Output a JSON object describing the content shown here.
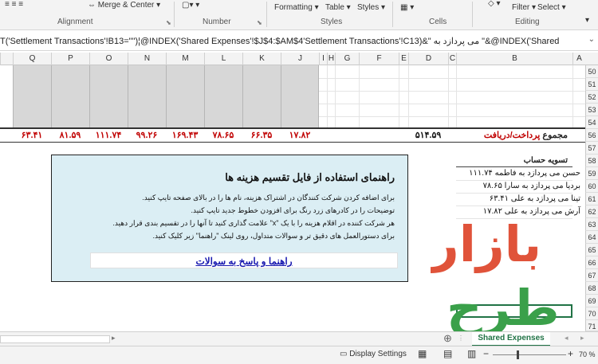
{
  "ribbon": {
    "groups": {
      "alignment": "Alignment",
      "number": "Number",
      "styles": "Styles",
      "cells": "Cells",
      "editing": "Editing"
    },
    "buttons": {
      "merge_center": "Merge & Center",
      "formatting": "Formatting",
      "table": "Table",
      "styles": "Styles",
      "filter": "Filter",
      "select": "Select"
    }
  },
  "formula_bar": {
    "text": "T('Settlement Transactions'!B13=\"\")¦@INDEX('Shared Expenses'!$J$4:$AM$4'Settlement Transactions'!C13)&\" می پردازد به \"&@INDEX('Shared"
  },
  "columns": [
    "Q",
    "P",
    "O",
    "N",
    "M",
    "L",
    "K",
    "J",
    "I",
    "H",
    "G",
    "F",
    "E",
    "D",
    "C",
    "B",
    "A"
  ],
  "rows": [
    "50",
    "51",
    "52",
    "53",
    "54",
    "55",
    "56",
    "57",
    "58",
    "59",
    "60",
    "61",
    "62",
    "63",
    "64",
    "65",
    "66",
    "67",
    "68",
    "69",
    "70",
    "71"
  ],
  "totals": {
    "values": [
      "۶۳.۴۱",
      "۸۱.۵۹",
      "۱۱۱.۷۴",
      "۹۹.۲۶",
      "۱۶۹.۴۳",
      "۷۸.۶۵",
      "۶۶.۳۵",
      "۱۷.۸۲"
    ],
    "grand_total": "۵۱۴.۵۹",
    "label_prefix": "مجموع ",
    "label_highlight": "پرداخت/دریافت"
  },
  "help": {
    "title": "راهنمای استفاده از فایل تقسیم هزینه ها",
    "lines": [
      "برای اضافه کردن شرکت کنندگان در اشتراک هزینه، نام ها را در بالای صفحه تایپ کنید.",
      "توضیحات را در کادرهای زرد رنگ برای افزودن خطوط جدید تایپ کنید.",
      "هر شرکت کننده در اقلام هزینه را با یک \"x\" علامت گذاری کنید تا آنها را در تقسیم بندی قرار دهید.",
      "برای دستورالعمل های دقیق تر و سوالات متداول، روی لینک \"راهنما\" زیر کلیک کنید."
    ],
    "link": "راهنما و پاسخ به سوالات"
  },
  "settlement": {
    "title": "تسویه حساب",
    "lines": [
      "حسن می پردازد به فاطمه ۱۱۱.۷۴",
      "بردیا می پردازد به سارا ۷۸.۶۵",
      "تینا می پردازد به علی ۶۳.۴۱",
      "آرش می پردازد به علی ۱۷.۸۲"
    ]
  },
  "watermark": {
    "word1": "بازار",
    "word2": "طرح",
    "color_red": "#e0533a",
    "color_green": "#3aa04a"
  },
  "sheet_tab": "Shared Expenses",
  "status": {
    "display_settings": "Display Settings",
    "zoom": "70 %"
  },
  "colors": {
    "accent": "#217346",
    "total_red": "#c00000",
    "help_bg": "#dbeef4",
    "link_blue": "#1a1ab0"
  }
}
